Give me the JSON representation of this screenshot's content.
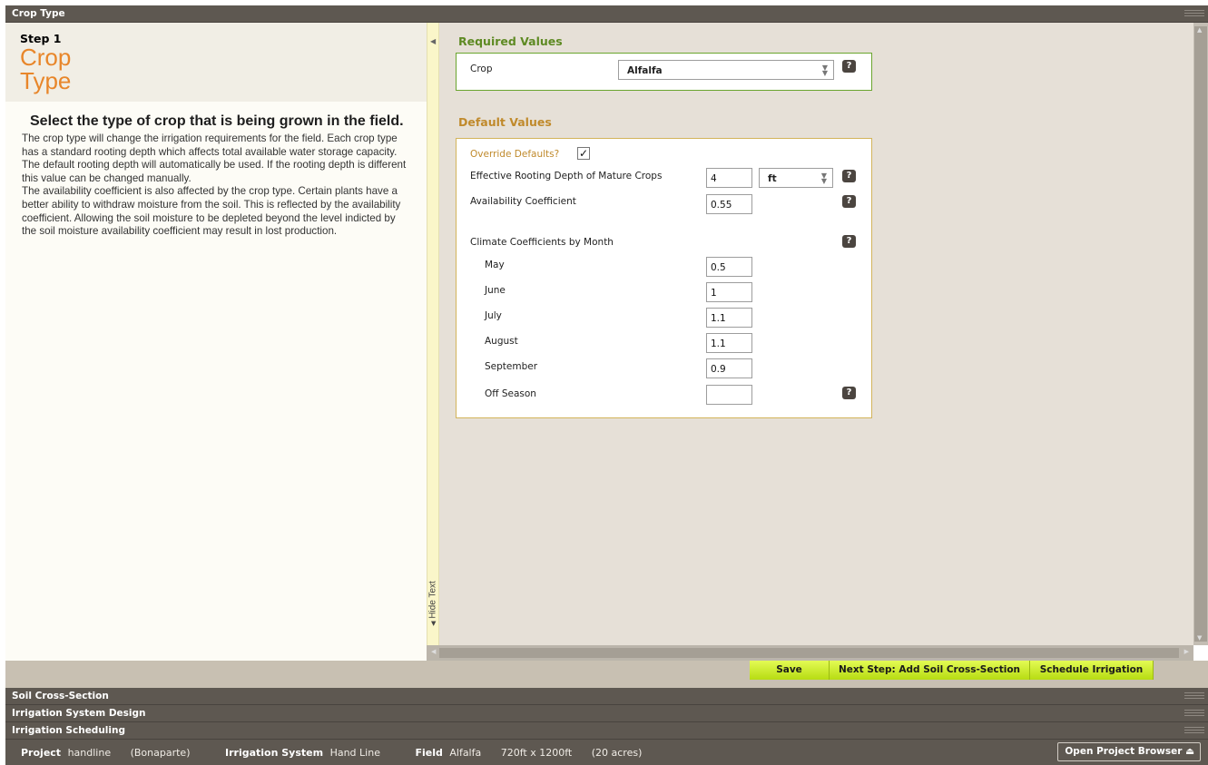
{
  "panels": {
    "crop_type": "Crop Type",
    "soil_cross_section": "Soil Cross-Section",
    "irrigation_system_design": "Irrigation System Design",
    "irrigation_scheduling": "Irrigation Scheduling"
  },
  "step": {
    "number": "Step 1",
    "title_line1": "Crop",
    "title_line2": "Type"
  },
  "help": {
    "heading": "Select the type of crop that is being grown in the field.",
    "paragraph1": "The crop type will change the irrigation requirements for the field. Each crop type has a standard rooting depth which affects total available water storage capacity. The default rooting depth will automatically be used. If the rooting depth is different this value can be changed manually.",
    "paragraph2": "The availability coefficient is also affected by the crop type. Certain plants have a better ability to withdraw moisture from the soil. This is reflected by the availability coefficient. Allowing the soil moisture to be depleted beyond the level indicted by the soil moisture availability coefficient may result in lost production.",
    "hide_text_label": "Hide Text"
  },
  "required": {
    "title": "Required Values",
    "crop_label": "Crop",
    "crop_value": "Alfalfa"
  },
  "defaults": {
    "title": "Default Values",
    "override_label": "Override Defaults?",
    "override_checked": true,
    "rooting_depth_label": "Effective Rooting Depth of Mature Crops",
    "rooting_depth_value": "4",
    "rooting_depth_unit": "ft",
    "availability_label": "Availability Coefficient",
    "availability_value": "0.55",
    "climate_label": "Climate Coefficients by Month",
    "months": [
      {
        "label": "May",
        "value": "0.5"
      },
      {
        "label": "June",
        "value": "1"
      },
      {
        "label": "July",
        "value": "1.1"
      },
      {
        "label": "August",
        "value": "1.1"
      },
      {
        "label": "September",
        "value": "0.9"
      },
      {
        "label": "Off Season",
        "value": ""
      }
    ]
  },
  "help_icon": "?",
  "buttons": {
    "save": "Save",
    "next_step": "Next Step: Add Soil Cross-Section",
    "schedule": "Schedule Irrigation"
  },
  "status": {
    "project_label": "Project",
    "project_name": "handline",
    "project_location": "(Bonaparte)",
    "system_label": "Irrigation System",
    "system_value": "Hand Line",
    "field_label": "Field",
    "field_crop": "Alfalfa",
    "field_size": "720ft x 1200ft",
    "field_acres": "(20 acres)",
    "open_browser": "Open Project Browser"
  },
  "icons": {
    "help": "question-icon",
    "collapse": "triangle-left-icon",
    "select_arrow": "double-chevron-down-icon",
    "eject": "eject-icon",
    "grip": "grip-lines-icon"
  },
  "colors": {
    "accent_orange": "#e8862a",
    "required_green": "#5e8a23",
    "default_gold": "#c08a2c",
    "button_lime": "#c8ea20",
    "panel_dark": "#5e5851"
  }
}
